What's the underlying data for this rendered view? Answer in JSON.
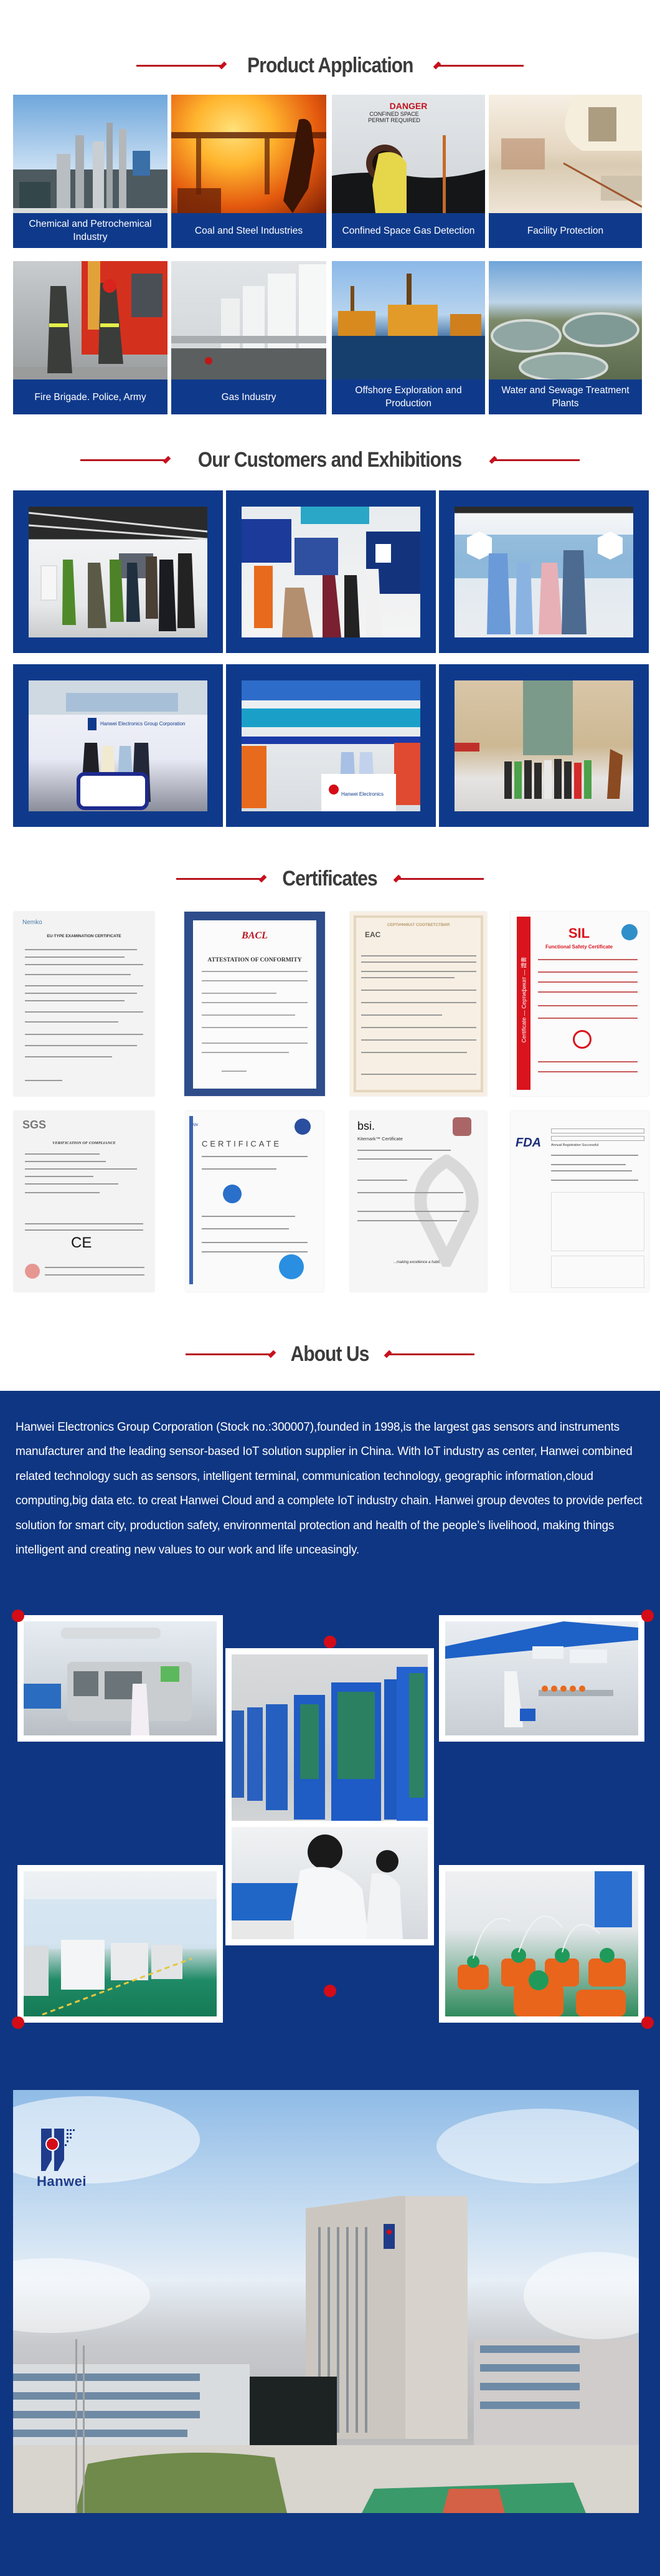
{
  "sections": {
    "product_application": {
      "title": "Product Application",
      "tiles": [
        {
          "label": "Chemical and Petrochemical Industry",
          "image": "refinery-photo"
        },
        {
          "label": "Coal and Steel Industries",
          "image": "molten-steel-photo"
        },
        {
          "label": "Confined Space Gas Detection",
          "image": "confined-space-photo",
          "sign": {
            "line1": "DANGER",
            "line2": "CONFINED SPACE",
            "line3": "PERMIT REQUIRED"
          }
        },
        {
          "label": "Facility Protection",
          "image": "shopping-mall-photo"
        },
        {
          "label": "Fire Brigade. Police, Army",
          "image": "firefighters-photo"
        },
        {
          "label": "Gas Industry",
          "image": "gas-tanks-photo"
        },
        {
          "label": "Offshore Exploration and Production",
          "image": "offshore-rig-photo"
        },
        {
          "label": "Water and Sewage Treatment Plants",
          "image": "water-treatment-photo"
        }
      ]
    },
    "customers": {
      "title": "Our Customers and Exhibitions",
      "photos": [
        {
          "image": "showroom-visit-photo"
        },
        {
          "image": "exhibition-booth-photo"
        },
        {
          "image": "customer-group-photo"
        },
        {
          "image": "hanwei-booth-photo",
          "caption_text": "Hanwei Electronics Group Corporation"
        },
        {
          "image": "hanwei-electronics-booth-photo",
          "caption_text": "Hanwei Electronics"
        },
        {
          "image": "lobby-group-photo"
        }
      ]
    },
    "certificates": {
      "title": "Certificates",
      "items": [
        {
          "issuer": "Nemko",
          "heading": "EU-TYPE EXAMINATION CERTIFICATE"
        },
        {
          "issuer": "BACL",
          "heading": "ATTESTATION OF CONFORMITY"
        },
        {
          "issuer": "EAC",
          "heading": "СЕРТИФИКАТ СООТВЕТСТВИЯ"
        },
        {
          "issuer": "SIL",
          "heading": "Functional Safety Certificate",
          "side_text": "Certificate — Сертификат — 證書"
        },
        {
          "issuer": "SGS",
          "heading": "VERIFICATION OF COMPLIANCE",
          "mark": "CE"
        },
        {
          "issuer": "TÜV",
          "heading": "CERTIFICATE"
        },
        {
          "issuer": "bsi.",
          "heading": "Kitemark™ Certificate",
          "footer": "...making excellence a habit."
        },
        {
          "issuer": "FDA",
          "heading": "Annual Registration Successful"
        }
      ]
    },
    "about": {
      "title": "About Us",
      "paragraph": "Hanwei Electronics Group Corporation (Stock no.:300007),founded in 1998,is the largest gas sensors and instruments manufacturer and the leading sensor-based IoT solution supplier in China. With IoT industry as center, Hanwei combined related technology such as sensors, intelligent terminal, communication technology, geographic information,cloud computing,big data etc. to creat Hanwei Cloud and a complete IoT industry chain. Hanwei group devotes to provide perfect solution for smart city, production safety, environmental protection and health of the people’s livelihood, making things intelligent and creating new values to our work and life unceasingly.",
      "factory_photos": [
        {
          "image": "soldering-machine-photo"
        },
        {
          "image": "aging-racks-photo"
        },
        {
          "image": "assembly-line-photo"
        },
        {
          "image": "smt-line-photo"
        },
        {
          "image": "worker-assembly-photo"
        },
        {
          "image": "gas-detectors-photo"
        }
      ],
      "campus": {
        "logo_text": "Hanwei",
        "image": "headquarters-photo"
      }
    }
  },
  "colors": {
    "brand_blue": "#0f3a8b",
    "accent_red": "#c8101c",
    "heading_gray": "#3b3b3b"
  }
}
